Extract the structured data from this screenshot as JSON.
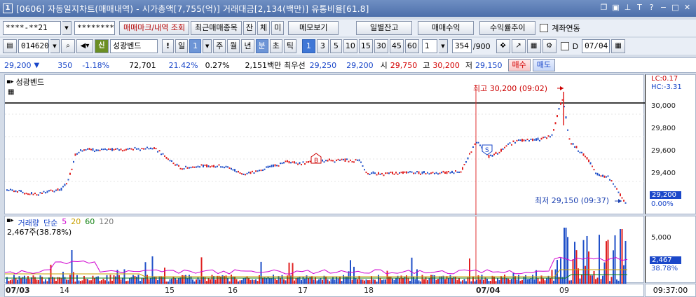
{
  "window": {
    "number": "1",
    "title": "[0606] 자동일지차트(매매내역) - 시가총액[7,755(억)] 거래대금[2,134(백만)] 유통비율[61.8]"
  },
  "toolbar1": {
    "account": "****-**21",
    "password": "********",
    "trade_mark_btn": "매매마크/내역 조회",
    "recent_trades_btn": "최근매매종목",
    "jan_btn": "잔",
    "che_btn": "체",
    "mi_btn": "미",
    "memo_btn": "메모보기",
    "daily_balance_btn": "일별잔고",
    "trade_profit_btn": "매매수익",
    "return_trend_btn": "수익률추이",
    "account_link_label": "계좌연동"
  },
  "toolbar2": {
    "stock_code": "014620",
    "stock_badge": "신",
    "stock_name": "성광벤드",
    "warn_btn": "!",
    "period_label": "일",
    "period_value": "1",
    "week_btn": "주",
    "month_btn": "월",
    "year_btn": "년",
    "minute_btn": "분",
    "second_btn": "초",
    "tick_btn": "틱",
    "intervals": [
      "1",
      "3",
      "5",
      "10",
      "15",
      "30",
      "45",
      "60"
    ],
    "custom_interval": "1",
    "count_value": "354",
    "count_total": "/900",
    "d_label": "D",
    "date_value": "07/04"
  },
  "quote": {
    "price": "29,200",
    "change": "350",
    "change_pct": "-1.18%",
    "volume": "72,701",
    "vol_ratio": "21.42%",
    "turnover": "0.27%",
    "amount": "2,151백만",
    "best_label": "최우선",
    "best_ask": "29,250",
    "best_bid": "29,200",
    "open_label": "시",
    "open": "29,750",
    "high_label": "고",
    "high": "30,200",
    "low_label": "저",
    "low": "29,150",
    "buy_btn": "매수",
    "sell_btn": "매도"
  },
  "chart_data": {
    "type": "candlestick",
    "title": "성광벤드",
    "price_ticks": [
      "30,000",
      "29,800",
      "29,600",
      "29,400"
    ],
    "current_price_label": "29,200",
    "current_pct_label": "0.00%",
    "lc_label": "LC:0.17",
    "hc_label": "HC:-3.31",
    "high_annotation": "최고 30,200 (09:02)",
    "low_annotation": "최저 29,150 (09:37)",
    "ylim": [
      29100,
      30350
    ],
    "reference_line": 30100,
    "trade_marks": [
      "B",
      "S"
    ],
    "x_labels": [
      "07/03",
      "14",
      "15",
      "16",
      "17",
      "18",
      "07/04",
      "09"
    ],
    "colors": {
      "up": "#e02020",
      "down": "#2050c8"
    }
  },
  "volume_chart": {
    "title": "거래량",
    "ma_label": "단순",
    "ma_periods": [
      {
        "period": "5",
        "color": "#d000d0"
      },
      {
        "period": "20",
        "color": "#c8a000"
      },
      {
        "period": "60",
        "color": "#108010"
      },
      {
        "period": "120",
        "color": "#777777"
      }
    ],
    "current_volume": "2,467주(38.78%)",
    "axis_tick": "5,000",
    "current_value_label": "2,467",
    "current_pct_label": "38.78%"
  },
  "xaxis_time": "09:37:00"
}
